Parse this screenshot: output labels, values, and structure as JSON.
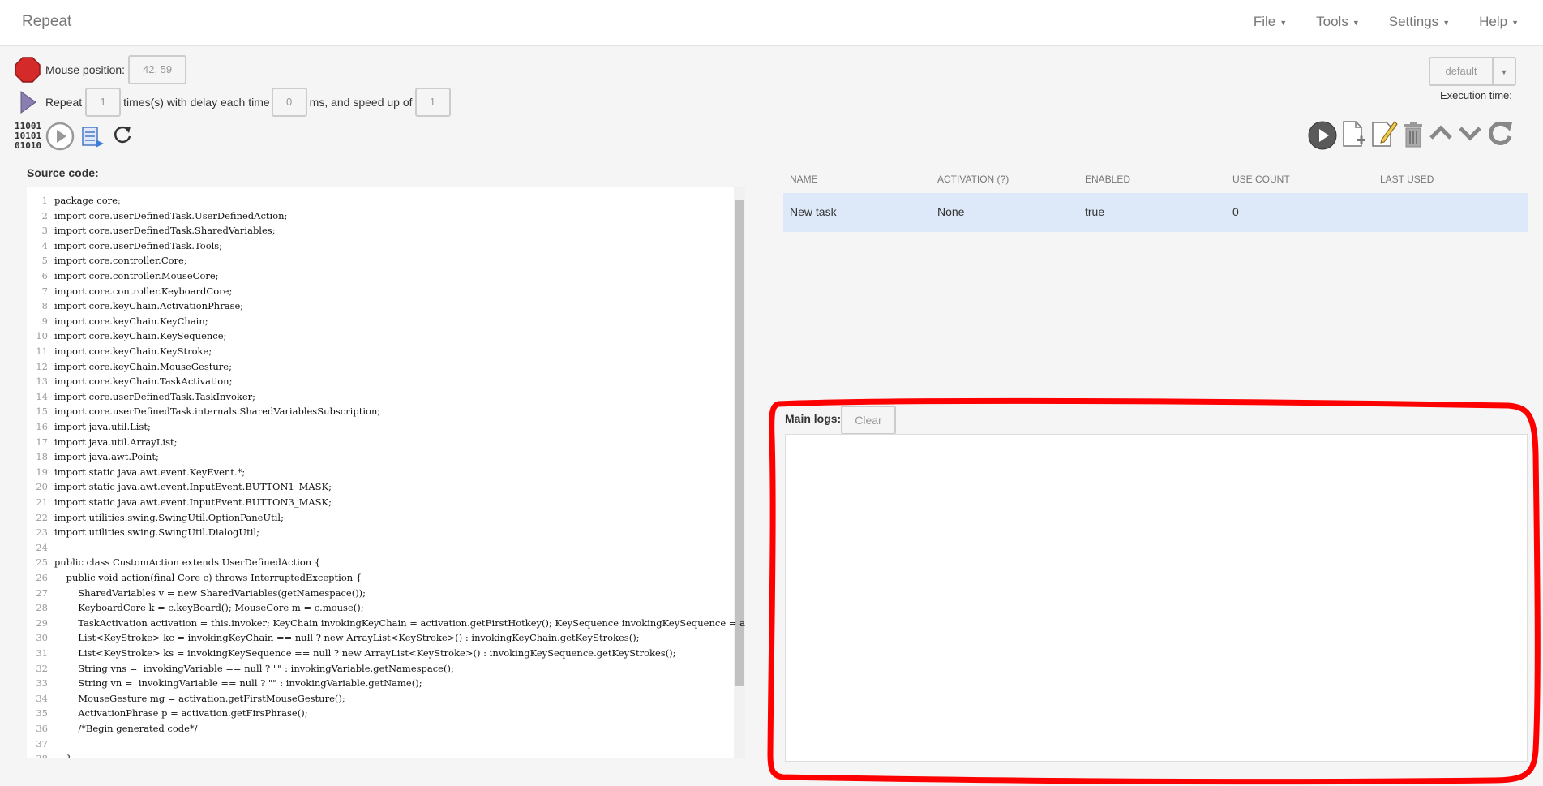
{
  "app": {
    "title": "Repeat"
  },
  "menu": [
    {
      "label": "File"
    },
    {
      "label": "Tools"
    },
    {
      "label": "Settings"
    },
    {
      "label": "Help"
    }
  ],
  "controls": {
    "mouse_position_label": "Mouse position:",
    "mouse_position_value": "42, 59",
    "repeat_label": "Repeat",
    "repeat_count": "1",
    "delay_label": "times(s) with delay each time",
    "delay_value": "0",
    "speed_label": "ms, and speed up of",
    "speed_value": "1",
    "profile_value": "default",
    "execution_time_label": "Execution time:"
  },
  "source": {
    "label": "Source code:",
    "lines": [
      "package core;",
      "import core.userDefinedTask.UserDefinedAction;",
      "import core.userDefinedTask.SharedVariables;",
      "import core.userDefinedTask.Tools;",
      "import core.controller.Core;",
      "import core.controller.MouseCore;",
      "import core.controller.KeyboardCore;",
      "import core.keyChain.ActivationPhrase;",
      "import core.keyChain.KeyChain;",
      "import core.keyChain.KeySequence;",
      "import core.keyChain.KeyStroke;",
      "import core.keyChain.MouseGesture;",
      "import core.keyChain.TaskActivation;",
      "import core.userDefinedTask.TaskInvoker;",
      "import core.userDefinedTask.internals.SharedVariablesSubscription;",
      "import java.util.List;",
      "import java.util.ArrayList;",
      "import java.awt.Point;",
      "import static java.awt.event.KeyEvent.*;",
      "import static java.awt.event.InputEvent.BUTTON1_MASK;",
      "import static java.awt.event.InputEvent.BUTTON3_MASK;",
      "import utilities.swing.SwingUtil.OptionPaneUtil;",
      "import utilities.swing.SwingUtil.DialogUtil;",
      "",
      "public class CustomAction extends UserDefinedAction {",
      "    public void action(final Core c) throws InterruptedException {",
      "        SharedVariables v = new SharedVariables(getNamespace());",
      "        KeyboardCore k = c.keyBoard(); MouseCore m = c.mouse();",
      "        TaskActivation activation = this.invoker; KeyChain invokingKeyChain = activation.getFirstHotkey(); KeySequence invokingKeySequence = activation.g",
      "        List<KeyStroke> kc = invokingKeyChain == null ? new ArrayList<KeyStroke>() : invokingKeyChain.getKeyStrokes();",
      "        List<KeyStroke> ks = invokingKeySequence == null ? new ArrayList<KeyStroke>() : invokingKeySequence.getKeyStrokes();",
      "        String vns =  invokingVariable == null ? \"\" : invokingVariable.getNamespace();",
      "        String vn =  invokingVariable == null ? \"\" : invokingVariable.getName();",
      "        MouseGesture mg = activation.getFirstMouseGesture();",
      "        ActivationPhrase p = activation.getFirsPhrase();",
      "        /*Begin generated code*/",
      "",
      "    }"
    ]
  },
  "tasks": {
    "headers": [
      "NAME",
      "ACTIVATION (?)",
      "ENABLED",
      "USE COUNT",
      "LAST USED"
    ],
    "rows": [
      [
        "New task",
        "None",
        "true",
        "0",
        ""
      ]
    ]
  },
  "logs": {
    "label": "Main logs:",
    "clear_label": "Clear"
  },
  "colors": {
    "annotation": "#ff0000",
    "selected_row": "#dde9f8"
  }
}
